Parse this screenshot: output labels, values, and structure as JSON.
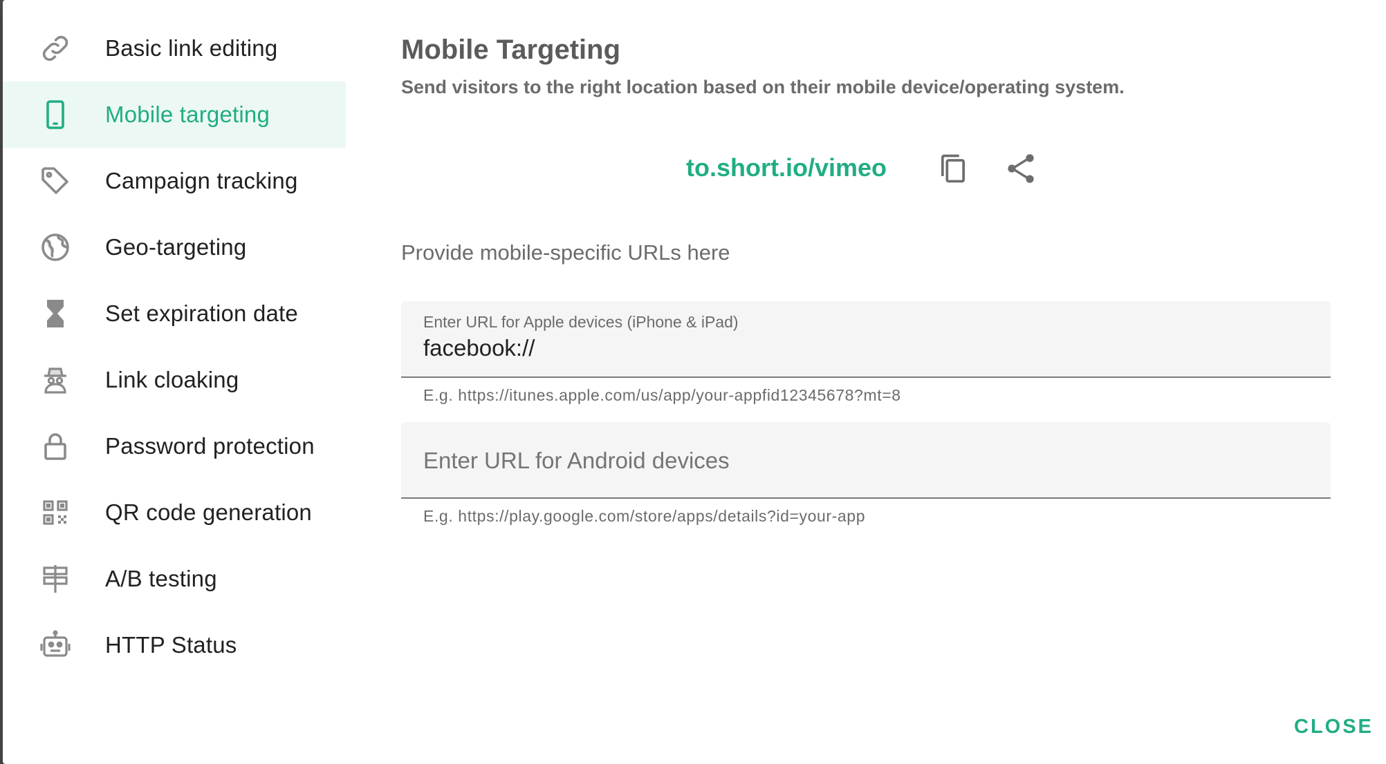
{
  "sidebar": {
    "items": [
      {
        "label": "Basic link editing",
        "icon": "link-icon",
        "active": false
      },
      {
        "label": "Mobile targeting",
        "icon": "smartphone-icon",
        "active": true
      },
      {
        "label": "Campaign tracking",
        "icon": "tag-icon",
        "active": false
      },
      {
        "label": "Geo-targeting",
        "icon": "globe-icon",
        "active": false
      },
      {
        "label": "Set expiration date",
        "icon": "hourglass-icon",
        "active": false
      },
      {
        "label": "Link cloaking",
        "icon": "incognito-icon",
        "active": false
      },
      {
        "label": "Password protection",
        "icon": "lock-icon",
        "active": false
      },
      {
        "label": "QR code generation",
        "icon": "qr-code-icon",
        "active": false
      },
      {
        "label": "A/B testing",
        "icon": "signpost-icon",
        "active": false
      },
      {
        "label": "HTTP Status",
        "icon": "robot-icon",
        "active": false
      }
    ]
  },
  "main": {
    "title": "Mobile Targeting",
    "subtitle": "Send visitors to the right location based on their mobile device/operating system.",
    "short_link": "to.short.io/vimeo",
    "copy_icon": "copy-icon",
    "share_icon": "share-icon",
    "section_label": "Provide mobile-specific URLs here",
    "apple_field": {
      "label": "Enter URL for Apple devices (iPhone & iPad)",
      "value": "facebook://",
      "hint": "E.g. https://itunes.apple.com/us/app/your-appfid12345678?mt=8"
    },
    "android_field": {
      "placeholder": "Enter URL for Android devices",
      "value": "",
      "hint": "E.g. https://play.google.com/store/apps/details?id=your-app"
    }
  },
  "footer": {
    "close_label": "CLOSE"
  },
  "colors": {
    "accent": "#21ad84",
    "active_bg": "#ecf8f3",
    "icon_gray": "#8a8a8a",
    "field_bg": "#f5f5f5"
  }
}
